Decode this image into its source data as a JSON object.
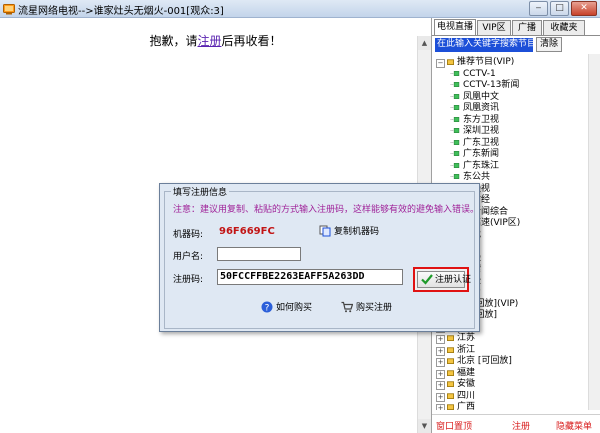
{
  "window": {
    "title": "流星网络电视-->谁家灶头无烟火-001[观众:3]",
    "buttons": {
      "minimize": "‒",
      "maximize": "□",
      "close": "✕"
    }
  },
  "main": {
    "notice_before": "抱歉，请",
    "notice_link": "注册",
    "notice_after": "后再收看！"
  },
  "right_panel": {
    "tabs": [
      {
        "label": "电视直播",
        "active": true
      },
      {
        "label": "VIP区",
        "active": false
      },
      {
        "label": "广播",
        "active": false
      },
      {
        "label": "收藏夹",
        "active": false
      }
    ],
    "search_placeholder": "在此输入关键字搜索节目",
    "clear_label": "清除",
    "tree": [
      {
        "label": "推荐节目(VIP)",
        "level": 0,
        "type": "group",
        "expander": "−"
      },
      {
        "label": "CCTV-1",
        "level": 1,
        "type": "channel"
      },
      {
        "label": "CCTV-13新闻",
        "level": 1,
        "type": "channel"
      },
      {
        "label": "凤凰中文",
        "level": 1,
        "type": "channel"
      },
      {
        "label": "凤凰资讯",
        "level": 1,
        "type": "channel"
      },
      {
        "label": "东方卫视",
        "level": 1,
        "type": "channel"
      },
      {
        "label": "深圳卫视",
        "level": 1,
        "type": "channel"
      },
      {
        "label": "广东卫视",
        "level": 1,
        "type": "channel"
      },
      {
        "label": "广东新闻",
        "level": 1,
        "type": "channel"
      },
      {
        "label": "广东珠江",
        "level": 1,
        "type": "channel"
      },
      {
        "label": "东公共",
        "level": 1,
        "type": "channel"
      },
      {
        "label": "方经视",
        "level": 1,
        "type": "channel"
      },
      {
        "label": "一财经",
        "level": 1,
        "type": "channel"
      },
      {
        "label": "海新闻综合",
        "level": 1,
        "type": "channel"
      },
      {
        "label": "清高速(VIP区)",
        "level": 1,
        "type": "channel"
      },
      {
        "label": "游戏",
        "level": 1,
        "type": "channel"
      },
      {
        "label": "道",
        "level": 1,
        "type": "channel"
      },
      {
        "label": "财经",
        "level": 1,
        "type": "channel"
      },
      {
        "label": "探索",
        "level": 1,
        "type": "channel"
      },
      {
        "label": "动漫",
        "level": 1,
        "type": "channel"
      },
      {
        "label": "视台",
        "level": 1,
        "type": "channel"
      },
      {
        "label": "[可回放](VIP)",
        "level": 1,
        "type": "channel"
      },
      {
        "label": "[可回放]",
        "level": 1,
        "type": "channel"
      },
      {
        "label": "湖南",
        "level": 0,
        "type": "group",
        "expander": "+"
      },
      {
        "label": "江苏",
        "level": 0,
        "type": "group",
        "expander": "+"
      },
      {
        "label": "浙江",
        "level": 0,
        "type": "group",
        "expander": "+"
      },
      {
        "label": "北京 [可回放]",
        "level": 0,
        "type": "group",
        "expander": "+"
      },
      {
        "label": "福建",
        "level": 0,
        "type": "group",
        "expander": "+"
      },
      {
        "label": "安徽",
        "level": 0,
        "type": "group",
        "expander": "+"
      },
      {
        "label": "四川",
        "level": 0,
        "type": "group",
        "expander": "+"
      },
      {
        "label": "广西",
        "level": 0,
        "type": "group",
        "expander": "+"
      }
    ],
    "bottom_links": {
      "left": "窗口置顶",
      "middle": "注册",
      "right": "隐藏菜单"
    }
  },
  "dialog": {
    "group_title": "填写注册信息",
    "note": "注意：建议用复制、粘贴的方式输入注册码，这样能够有效的避免输入错误。",
    "machine_code_label": "机器码:",
    "machine_code_value": "96F669FC",
    "copy_button": "复制机器码",
    "username_label": "用户名:",
    "username_value": "",
    "regcode_label": "注册码:",
    "regcode_value": "50FCCFFBE2263EAFF5A263DD",
    "verify_button": "注册认证",
    "how_to_buy": "如何购买",
    "buy_register": "购买注册"
  },
  "colors": {
    "accent_red": "#e01212",
    "link_purple": "#5a23b0",
    "note_magenta": "#a0249a",
    "search_blue": "#1c4fd8"
  }
}
